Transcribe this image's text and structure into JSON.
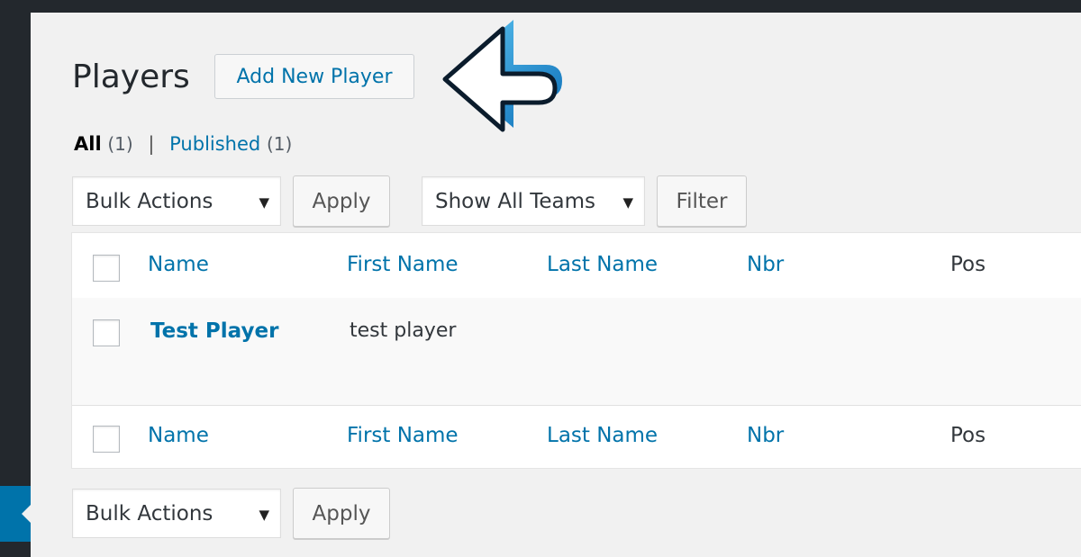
{
  "page": {
    "title": "Players",
    "add_new_label": "Add New Player"
  },
  "views": {
    "all_label": "All",
    "all_count": "(1)",
    "separator": "|",
    "published_label": "Published",
    "published_count": "(1)"
  },
  "top_nav": {
    "bulk_actions": "Bulk Actions",
    "apply_label": "Apply",
    "team_filter": "Show All Teams",
    "filter_label": "Filter"
  },
  "table": {
    "columns": [
      "Name",
      "First Name",
      "Last Name",
      "Nbr",
      "Pos"
    ],
    "rows": [
      {
        "name": "Test Player",
        "first_name": "test player",
        "last_name": "",
        "nbr": "",
        "pos": ""
      }
    ]
  },
  "bottom_nav": {
    "bulk_actions": "Bulk Actions",
    "apply_label": "Apply"
  },
  "icons": {
    "dropdown_caret": "▼"
  },
  "colors": {
    "link": "#0073aa",
    "admin_bar": "#23282d",
    "active_menu": "#0073aa",
    "annotation_arrow": "#1e9bd7"
  }
}
